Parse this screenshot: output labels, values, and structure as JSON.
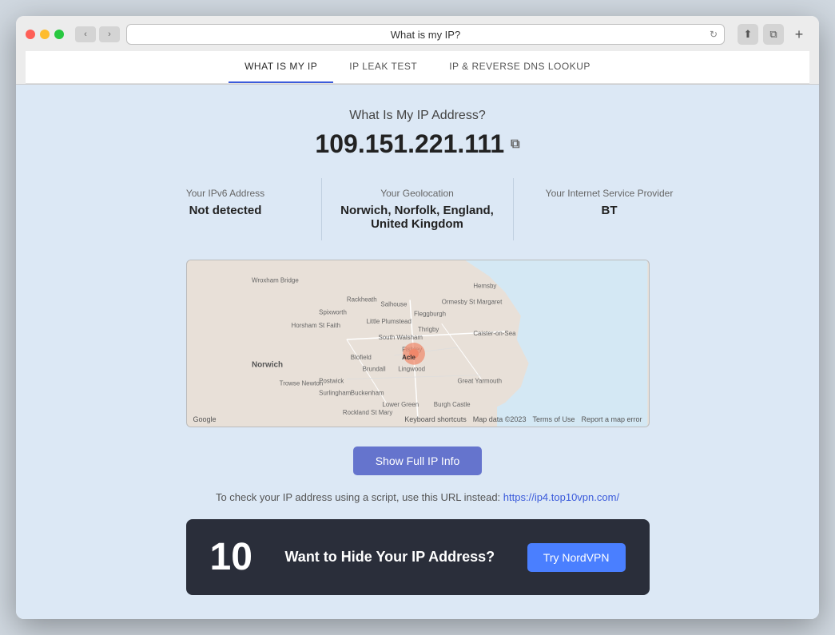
{
  "browser": {
    "address_bar_text": "What is my IP?",
    "back_label": "‹",
    "forward_label": "›",
    "reload_label": "↻",
    "share_label": "⬆",
    "sidebar_label": "⧉",
    "plus_label": "+"
  },
  "nav": {
    "tabs": [
      {
        "id": "what-is-my-ip",
        "label": "WHAT IS MY IP",
        "active": true
      },
      {
        "id": "ip-leak-test",
        "label": "IP LEAK TEST",
        "active": false
      },
      {
        "id": "ip-reverse-dns",
        "label": "IP & REVERSE DNS LOOKUP",
        "active": false
      }
    ]
  },
  "main": {
    "page_title": "What Is My IP Address?",
    "ip_address": "109.151.221.111",
    "copy_tooltip": "Copy",
    "info_cards": [
      {
        "label": "Your IPv6 Address",
        "value": "Not detected"
      },
      {
        "label": "Your Geolocation",
        "value": "Norwich, Norfolk, England, United Kingdom"
      },
      {
        "label": "Your Internet Service Provider",
        "value": "BT"
      }
    ],
    "map": {
      "attribution": "Google",
      "keyboard_shortcuts": "Keyboard shortcuts",
      "map_data": "Map data ©2023",
      "terms": "Terms of Use",
      "report": "Report a map error"
    },
    "show_ip_button": "Show Full IP Info",
    "script_url_text": "To check your IP address using a script, use this URL instead:",
    "script_url_link": "https://ip4.top10vpn.com/",
    "hide_cta": {
      "title": "Want to Hide Your IP Address?",
      "number": "10",
      "button_label": "Try NordVPN"
    }
  }
}
